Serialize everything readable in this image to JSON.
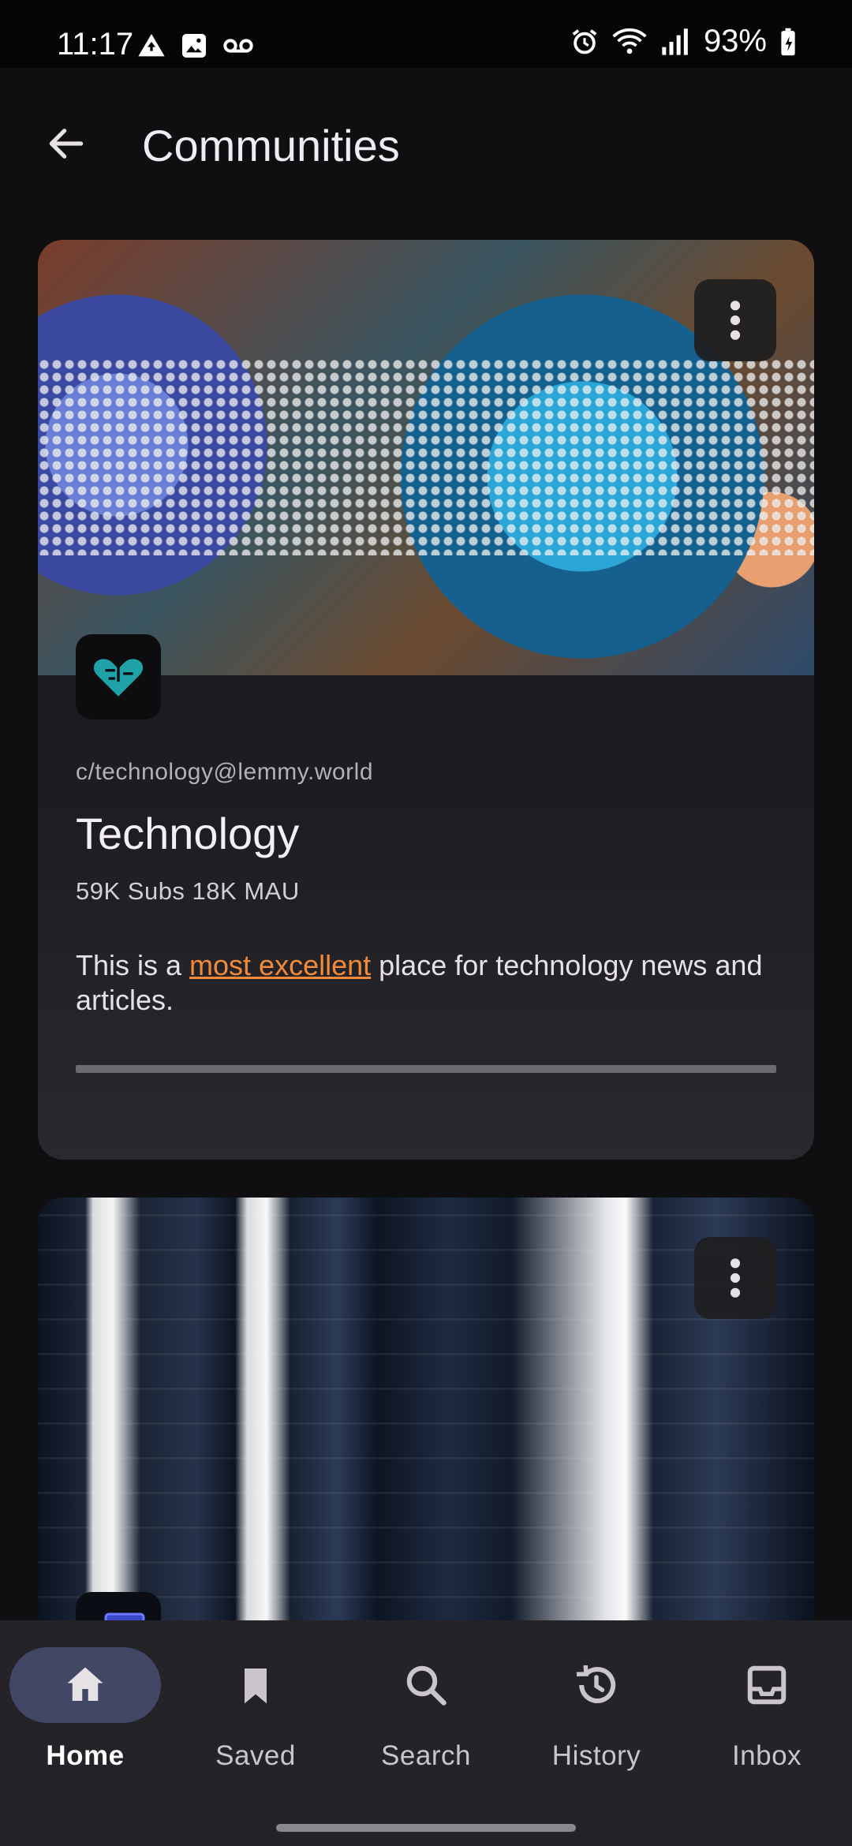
{
  "status_bar": {
    "time": "11:17",
    "battery": "93%"
  },
  "app_bar": {
    "title": "Communities"
  },
  "communities": [
    {
      "handle": "c/technology@lemmy.world",
      "name": "Technology",
      "stats": "59K Subs 18K MAU",
      "description_pre": "This is a ",
      "description_link": "most excellent",
      "description_post": " place for technology news and articles."
    },
    {}
  ],
  "bottom_nav": {
    "items": [
      {
        "label": "Home",
        "icon": "home-icon",
        "active": true
      },
      {
        "label": "Saved",
        "icon": "bookmark-icon",
        "active": false
      },
      {
        "label": "Search",
        "icon": "search-icon",
        "active": false
      },
      {
        "label": "History",
        "icon": "history-icon",
        "active": false
      },
      {
        "label": "Inbox",
        "icon": "inbox-icon",
        "active": false
      }
    ]
  },
  "colors": {
    "background": "#0f0f11",
    "card": "#1f1e22",
    "link": "#f28a3a",
    "nav_active_pill": "#424766"
  }
}
